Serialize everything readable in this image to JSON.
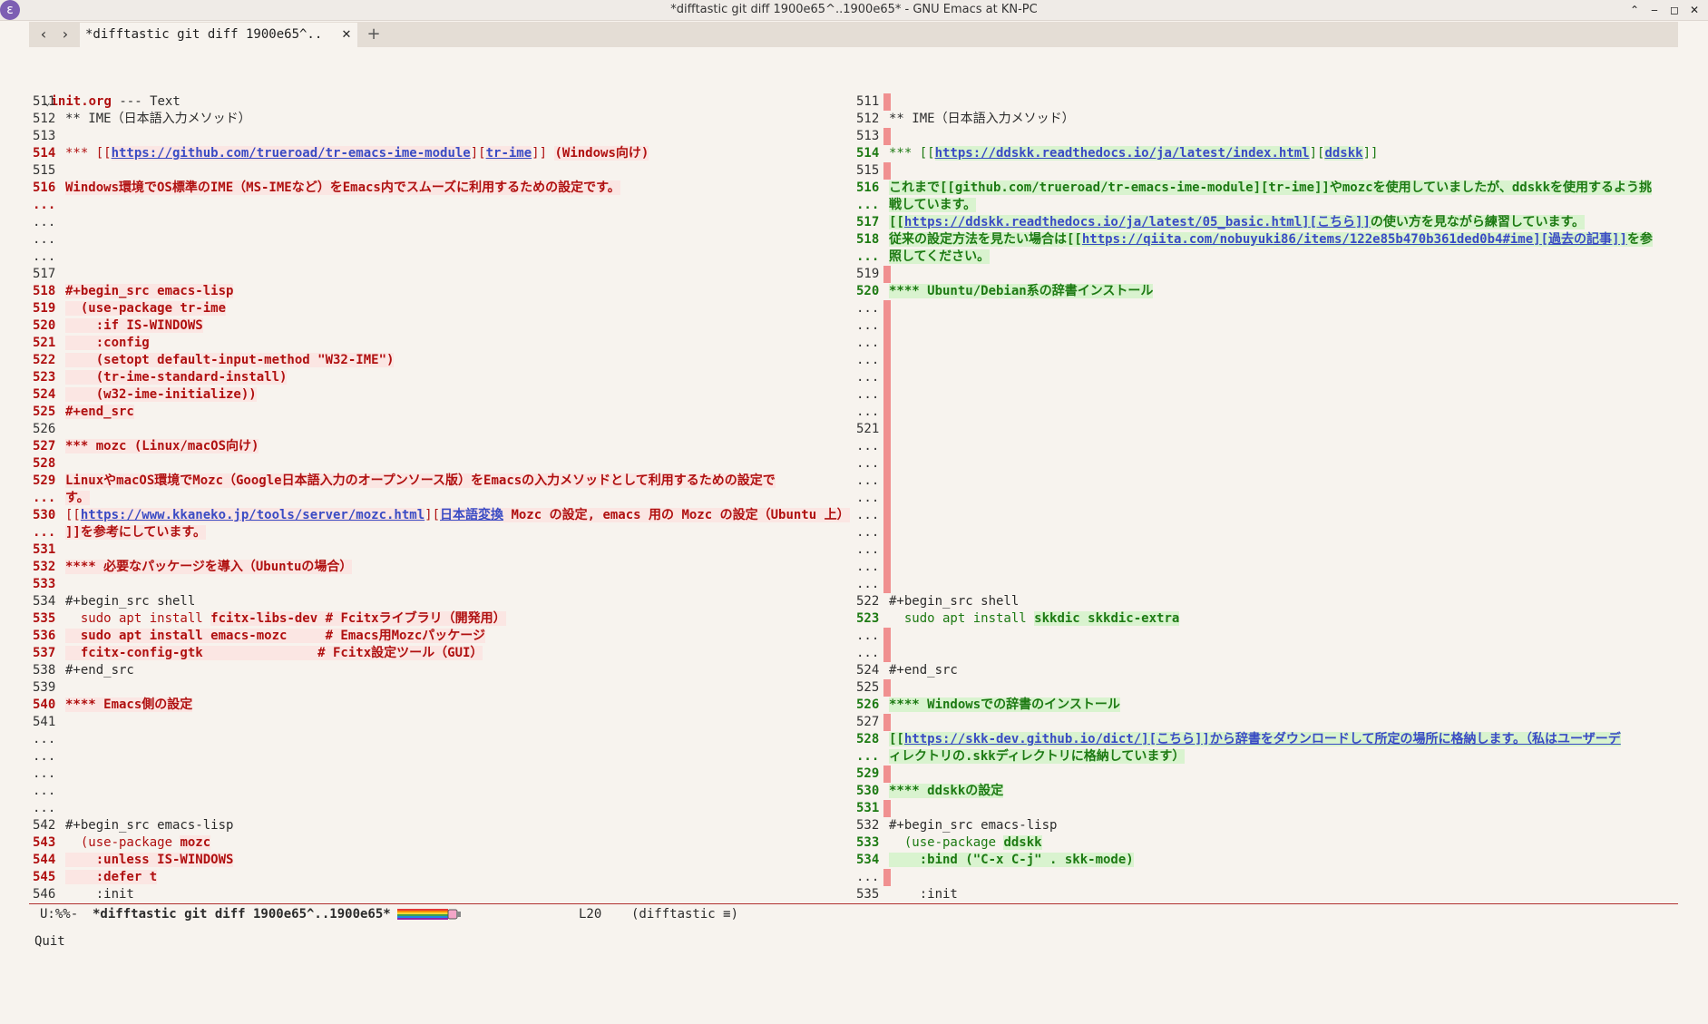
{
  "window": {
    "title": "*difftastic git diff 1900e65^..1900e65* - GNU Emacs at KN-PC",
    "app_icon": "emacs-icon",
    "controls": {
      "up": "⌃",
      "minimize": "‒",
      "maximize": "◻",
      "close": "✕"
    }
  },
  "tabbar": {
    "back": "‹",
    "forward": "›",
    "tab_label": "*difftastic git diff 1900e65^..",
    "tab_close": "✕",
    "add": "+"
  },
  "file": {
    "name": "init.org",
    "suffix": " --- Text"
  },
  "left_lines": [
    {
      "n": "511",
      "k": "plain",
      "s": []
    },
    {
      "n": "512",
      "k": "plain",
      "s": [
        {
          "t": "** IME（日本語入力メソッド）"
        }
      ]
    },
    {
      "n": "513",
      "k": "plain",
      "s": []
    },
    {
      "n": "514",
      "k": "rm",
      "s": [
        {
          "t": "*** [[",
          "c": "rm-p"
        },
        {
          "t": "https://github.com/trueroad/tr-emacs-ime-module",
          "c": "rm-t lnk"
        },
        {
          "t": "][",
          "c": "rm-p"
        },
        {
          "t": "tr-ime",
          "c": "rm-t lnk"
        },
        {
          "t": "]] ",
          "c": "rm-p"
        },
        {
          "t": "(Windows向け)",
          "c": "rm-t"
        }
      ]
    },
    {
      "n": "515",
      "k": "plain",
      "s": []
    },
    {
      "n": "516",
      "k": "rm",
      "s": [
        {
          "t": "Windows環境でOS標準のIME（MS-IMEなど）をEmacs内でスムーズに利用するための設定です。",
          "c": "rm-t"
        }
      ]
    },
    {
      "n": "...",
      "k": "rm",
      "s": []
    },
    {
      "n": "...",
      "k": "plain",
      "s": []
    },
    {
      "n": "...",
      "k": "plain",
      "s": []
    },
    {
      "n": "...",
      "k": "plain",
      "s": []
    },
    {
      "n": "517",
      "k": "plain",
      "s": []
    },
    {
      "n": "518",
      "k": "rm",
      "s": [
        {
          "t": "#+begin_src emacs-lisp",
          "c": "rm-t"
        }
      ]
    },
    {
      "n": "519",
      "k": "rm",
      "s": [
        {
          "t": "  (use-package tr-ime",
          "c": "rm-t"
        }
      ]
    },
    {
      "n": "520",
      "k": "rm",
      "s": [
        {
          "t": "    :if IS-WINDOWS",
          "c": "rm-t"
        }
      ]
    },
    {
      "n": "521",
      "k": "rm",
      "s": [
        {
          "t": "    :config",
          "c": "rm-t"
        }
      ]
    },
    {
      "n": "522",
      "k": "rm",
      "s": [
        {
          "t": "    (setopt default-input-method \"W32-IME\")",
          "c": "rm-t"
        }
      ]
    },
    {
      "n": "523",
      "k": "rm",
      "s": [
        {
          "t": "    (tr-ime-standard-install)",
          "c": "rm-t"
        }
      ]
    },
    {
      "n": "524",
      "k": "rm",
      "s": [
        {
          "t": "    (w32-ime-initialize))",
          "c": "rm-t"
        }
      ]
    },
    {
      "n": "525",
      "k": "rm",
      "s": [
        {
          "t": "#+end_src",
          "c": "rm-t"
        }
      ]
    },
    {
      "n": "526",
      "k": "plain",
      "s": []
    },
    {
      "n": "527",
      "k": "rm",
      "s": [
        {
          "t": "*** mozc (Linux/macOS向け)",
          "c": "rm-t"
        }
      ]
    },
    {
      "n": "528",
      "k": "rm",
      "s": []
    },
    {
      "n": "529",
      "k": "rm",
      "s": [
        {
          "t": "LinuxやmacOS環境でMozc（Google日本語入力のオープンソース版）をEmacsの入力メソッドとして利用するための設定で",
          "c": "rm-t"
        }
      ]
    },
    {
      "n": "...",
      "k": "rm",
      "s": [
        {
          "t": "す。",
          "c": "rm-t"
        }
      ]
    },
    {
      "n": "530",
      "k": "rm",
      "s": [
        {
          "t": "[[",
          "c": "rm-p"
        },
        {
          "t": "https://www.kkaneko.jp/tools/server/mozc.html",
          "c": "rm-t lnk"
        },
        {
          "t": "][",
          "c": "rm-p"
        },
        {
          "t": "日本語変換",
          "c": "rm-t lnk"
        },
        {
          "t": " Mozc の設定, emacs 用の Mozc の設定（Ubuntu 上）",
          "c": "rm-t"
        }
      ]
    },
    {
      "n": "...",
      "k": "rm",
      "s": [
        {
          "t": "]]を参考にしています。",
          "c": "rm-t"
        }
      ]
    },
    {
      "n": "531",
      "k": "rm",
      "s": []
    },
    {
      "n": "532",
      "k": "rm",
      "s": [
        {
          "t": "**** 必要なパッケージを導入（Ubuntuの場合）",
          "c": "rm-t"
        }
      ]
    },
    {
      "n": "533",
      "k": "rm",
      "s": []
    },
    {
      "n": "534",
      "k": "plain",
      "s": [
        {
          "t": "#+begin_src shell"
        }
      ]
    },
    {
      "n": "535",
      "k": "rm",
      "s": [
        {
          "t": "  sudo apt install ",
          "c": "rm-p"
        },
        {
          "t": "fcitx-libs-dev # Fcitxライブラリ（開発用）",
          "c": "rm-t"
        }
      ]
    },
    {
      "n": "536",
      "k": "rm",
      "s": [
        {
          "t": "  sudo apt install emacs-mozc     # Emacs用Mozcパッケージ",
          "c": "rm-t"
        }
      ]
    },
    {
      "n": "537",
      "k": "rm",
      "s": [
        {
          "t": "  fcitx-config-gtk               # Fcitx設定ツール（GUI）",
          "c": "rm-t"
        }
      ]
    },
    {
      "n": "538",
      "k": "plain",
      "s": [
        {
          "t": "#+end_src"
        }
      ]
    },
    {
      "n": "539",
      "k": "plain",
      "s": []
    },
    {
      "n": "540",
      "k": "rm",
      "s": [
        {
          "t": "**** Emacs側の設定",
          "c": "rm-t"
        }
      ]
    },
    {
      "n": "541",
      "k": "plain",
      "s": []
    },
    {
      "n": "...",
      "k": "plain",
      "s": []
    },
    {
      "n": "...",
      "k": "plain",
      "s": []
    },
    {
      "n": "...",
      "k": "plain",
      "s": []
    },
    {
      "n": "...",
      "k": "plain",
      "s": []
    },
    {
      "n": "...",
      "k": "plain",
      "s": []
    },
    {
      "n": "542",
      "k": "plain",
      "s": [
        {
          "t": "#+begin_src emacs-lisp"
        }
      ]
    },
    {
      "n": "543",
      "k": "rm",
      "s": [
        {
          "t": "  (use-package ",
          "c": "rm-p"
        },
        {
          "t": "mozc",
          "c": "rm-t"
        }
      ]
    },
    {
      "n": "544",
      "k": "rm",
      "s": [
        {
          "t": "    :unless IS-WINDOWS",
          "c": "rm-t"
        }
      ]
    },
    {
      "n": "545",
      "k": "rm",
      "s": [
        {
          "t": "    :defer t",
          "c": "rm-t"
        }
      ]
    },
    {
      "n": "546",
      "k": "plain",
      "s": [
        {
          "t": "    :init"
        }
      ]
    }
  ],
  "right_lines": [
    {
      "n": "511",
      "k": "plain",
      "m": true,
      "s": []
    },
    {
      "n": "512",
      "k": "plain",
      "s": [
        {
          "t": "** IME（日本語入力メソッド）"
        }
      ]
    },
    {
      "n": "513",
      "k": "plain",
      "m": true,
      "s": []
    },
    {
      "n": "514",
      "k": "add",
      "s": [
        {
          "t": "*** [[",
          "c": "add-p"
        },
        {
          "t": "https://ddskk.readthedocs.io/ja/latest/index.html",
          "c": "add-t lnk"
        },
        {
          "t": "][",
          "c": "add-p"
        },
        {
          "t": "ddskk",
          "c": "add-t lnk"
        },
        {
          "t": "]]",
          "c": "add-p"
        }
      ]
    },
    {
      "n": "515",
      "k": "plain",
      "m": true,
      "s": []
    },
    {
      "n": "516",
      "k": "add",
      "s": [
        {
          "t": "これまで[[github.com/trueroad/tr-emacs-ime-module][tr-ime]]やmozcを使用していましたが、ddskkを使用するよう挑",
          "c": "add-t"
        }
      ]
    },
    {
      "n": "...",
      "k": "add",
      "s": [
        {
          "t": "戦しています。",
          "c": "add-t"
        }
      ]
    },
    {
      "n": "517",
      "k": "add",
      "s": [
        {
          "t": "[[",
          "c": "add-t"
        },
        {
          "t": "https://ddskk.readthedocs.io/ja/latest/05_basic.html][こちら]]",
          "c": "add-t lnk"
        },
        {
          "t": "の使い方を見ながら練習しています。",
          "c": "add-t"
        }
      ]
    },
    {
      "n": "518",
      "k": "add",
      "s": [
        {
          "t": "従来の設定方法を見たい場合は[[",
          "c": "add-t"
        },
        {
          "t": "https://qiita.com/nobuyuki86/items/122e85b470b361ded0b4#ime][過去の記事]]",
          "c": "add-t lnk"
        },
        {
          "t": "を参",
          "c": "add-t"
        }
      ]
    },
    {
      "n": "...",
      "k": "add",
      "s": [
        {
          "t": "照してください。",
          "c": "add-t"
        }
      ]
    },
    {
      "n": "519",
      "k": "plain",
      "m": true,
      "s": []
    },
    {
      "n": "520",
      "k": "add",
      "s": [
        {
          "t": "**** Ubuntu/Debian系の辞書インストール",
          "c": "add-t"
        }
      ]
    },
    {
      "n": "...",
      "k": "plain",
      "m": true,
      "s": []
    },
    {
      "n": "...",
      "k": "plain",
      "m": true,
      "s": []
    },
    {
      "n": "...",
      "k": "plain",
      "m": true,
      "s": []
    },
    {
      "n": "...",
      "k": "plain",
      "m": true,
      "s": []
    },
    {
      "n": "...",
      "k": "plain",
      "m": true,
      "s": []
    },
    {
      "n": "...",
      "k": "plain",
      "m": true,
      "s": []
    },
    {
      "n": "...",
      "k": "plain",
      "m": true,
      "s": []
    },
    {
      "n": "521",
      "k": "plain",
      "m": true,
      "s": []
    },
    {
      "n": "...",
      "k": "plain",
      "m": true,
      "s": []
    },
    {
      "n": "...",
      "k": "plain",
      "m": true,
      "s": []
    },
    {
      "n": "...",
      "k": "plain",
      "m": true,
      "s": []
    },
    {
      "n": "...",
      "k": "plain",
      "m": true,
      "s": []
    },
    {
      "n": "...",
      "k": "plain",
      "m": true,
      "s": []
    },
    {
      "n": "...",
      "k": "plain",
      "m": true,
      "s": []
    },
    {
      "n": "...",
      "k": "plain",
      "m": true,
      "s": []
    },
    {
      "n": "...",
      "k": "plain",
      "m": true,
      "s": []
    },
    {
      "n": "...",
      "k": "plain",
      "m": true,
      "s": []
    },
    {
      "n": "522",
      "k": "plain",
      "s": [
        {
          "t": "#+begin_src shell"
        }
      ]
    },
    {
      "n": "523",
      "k": "add",
      "s": [
        {
          "t": "  sudo apt install ",
          "c": "add-p"
        },
        {
          "t": "skkdic skkdic-extra",
          "c": "add-t"
        }
      ]
    },
    {
      "n": "...",
      "k": "plain",
      "m": true,
      "s": []
    },
    {
      "n": "...",
      "k": "plain",
      "m": true,
      "s": []
    },
    {
      "n": "524",
      "k": "plain",
      "s": [
        {
          "t": "#+end_src"
        }
      ]
    },
    {
      "n": "525",
      "k": "plain",
      "m": true,
      "s": []
    },
    {
      "n": "526",
      "k": "add",
      "s": [
        {
          "t": "**** Windowsでの辞書のインストール",
          "c": "add-t"
        }
      ]
    },
    {
      "n": "527",
      "k": "plain",
      "m": true,
      "s": []
    },
    {
      "n": "528",
      "k": "add",
      "s": [
        {
          "t": "[[",
          "c": "add-t"
        },
        {
          "t": "https://skk-dev.github.io/dict/][こちら]]",
          "c": "add-t lnk"
        },
        {
          "t": "から辞書をダウンロードして所定の場所に格納します。（私はユーザーデ",
          "c": "add-t lnk"
        }
      ]
    },
    {
      "n": "...",
      "k": "add",
      "s": [
        {
          "t": "ィレクトリの.skkディレクトリに格納しています）",
          "c": "add-t"
        }
      ]
    },
    {
      "n": "529",
      "k": "add",
      "m": true,
      "s": []
    },
    {
      "n": "530",
      "k": "add",
      "s": [
        {
          "t": "**** ddskkの設定",
          "c": "add-t"
        }
      ]
    },
    {
      "n": "531",
      "k": "add",
      "m": true,
      "s": []
    },
    {
      "n": "532",
      "k": "plain",
      "s": [
        {
          "t": "#+begin_src emacs-lisp"
        }
      ]
    },
    {
      "n": "533",
      "k": "add",
      "s": [
        {
          "t": "  (use-package ",
          "c": "add-p"
        },
        {
          "t": "ddskk",
          "c": "add-t"
        }
      ]
    },
    {
      "n": "534",
      "k": "add",
      "s": [
        {
          "t": "    :bind (\"C-x C-j\" . skk-mode)",
          "c": "add-t"
        }
      ]
    },
    {
      "n": "...",
      "k": "plain",
      "m": true,
      "s": []
    },
    {
      "n": "535",
      "k": "plain",
      "s": [
        {
          "t": "    :init"
        }
      ]
    }
  ],
  "modeline": {
    "status": "U:%%-",
    "buffer": "*difftastic git diff 1900e65^..1900e65*",
    "position_icon": "nyan-cat-progress-icon",
    "line": "L20",
    "mode": "(difftastic ≡)"
  },
  "minibuffer": {
    "text": "Quit"
  },
  "colors": {
    "removed": "#b01010",
    "added": "#1d7a13",
    "marker": "#f09090",
    "link": "#3a4bc4"
  }
}
